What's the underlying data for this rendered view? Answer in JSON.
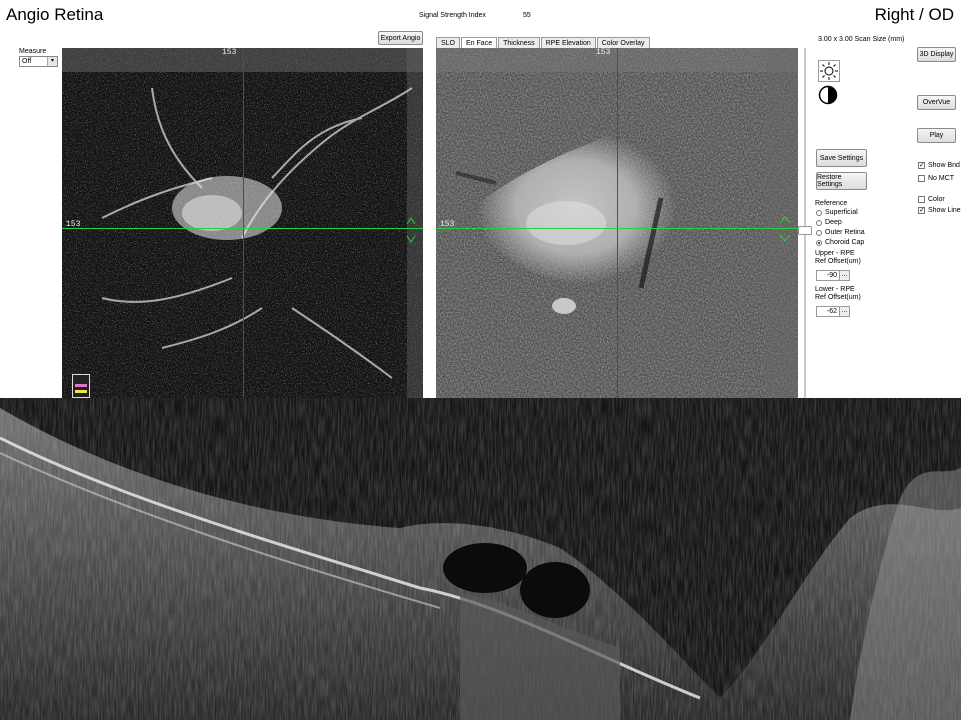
{
  "header": {
    "title": "Angio Retina",
    "ssi_label": "Signal Strength Index",
    "ssi_value": "55",
    "eye": "Right / OD"
  },
  "left_panel": {
    "measure_label": "Measure",
    "measure_value": "Off",
    "export_button": "Export Angio",
    "marker_top": "153",
    "marker_left": "153"
  },
  "tabs": [
    {
      "label": "SLO",
      "active": false
    },
    {
      "label": "En Face",
      "active": true
    },
    {
      "label": "Thickness",
      "active": false
    },
    {
      "label": "RPE Elevation",
      "active": false
    },
    {
      "label": "Color Overlay",
      "active": false
    }
  ],
  "right_image": {
    "marker_top": "153",
    "marker_left": "153"
  },
  "side": {
    "scan_size": "3.00 x 3.00 Scan Size (mm)",
    "display_3d": "3D Display",
    "overvue": "OverVue",
    "play": "Play",
    "save_settings": "Save Settings",
    "restore_settings": "Restore Settings",
    "reference_label": "Reference",
    "reference_options": [
      "Superficial",
      "Deep",
      "Outer Retina",
      "Choroid Cap"
    ],
    "reference_selected": "Choroid Cap",
    "upper_label": "Upper - RPE Ref Offset(um)",
    "upper_value": "-90",
    "lower_label": "Lower - RPE Ref Offset(um)",
    "lower_value": "-62",
    "ellipsis": "...",
    "checkboxes": [
      {
        "label": "Show Bnd",
        "checked": true
      },
      {
        "label": "No MCT",
        "checked": false
      },
      {
        "label": "Color",
        "checked": false
      },
      {
        "label": "Show Line",
        "checked": true
      }
    ]
  },
  "icons": {
    "brightness": "brightness-icon",
    "contrast": "contrast-icon"
  },
  "colors": {
    "crosshair_vertical": "#d31616",
    "crosshair_horizontal": "#2ecc40",
    "bscan_background": "#111111"
  }
}
